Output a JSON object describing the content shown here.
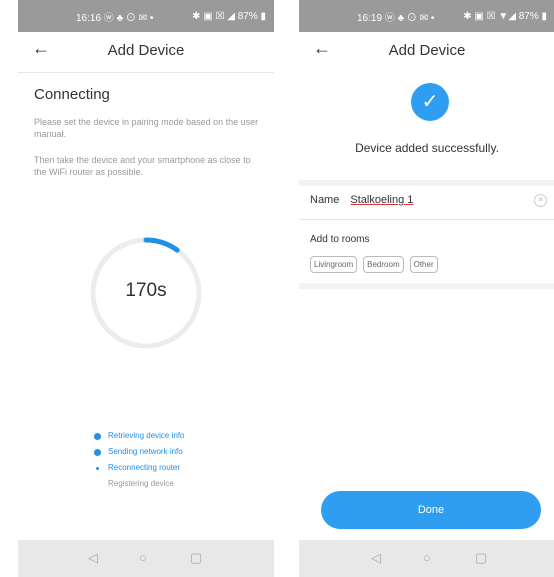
{
  "left": {
    "status": {
      "time_icons": "16:16 ⓦ ♣ ⊙ ✉ •",
      "right_icons": "✱ ▣ ☒ ◢ 87% ▮"
    },
    "header": {
      "title": "Add Device"
    },
    "heading": "Connecting",
    "instruction_1": "Please set the device in pairing mode based on the user manual.",
    "instruction_2": "Then take the device and your smartphone as close to the WiFi router as possible.",
    "countdown": "170s",
    "progress": 0.1,
    "steps": [
      {
        "label": "Retrieving device info",
        "state": "done"
      },
      {
        "label": "Sending network info",
        "state": "done"
      },
      {
        "label": "Reconnecting router",
        "state": "active"
      },
      {
        "label": "Registering device",
        "state": "pending"
      }
    ],
    "colors": {
      "accent": "#1e90e8",
      "done_text": "#1e90e8",
      "pending_text": "#999999"
    }
  },
  "right": {
    "status": {
      "time_icons": "16:19 ⓦ ♣ ⊙ ✉ •",
      "right_icons": "✱ ▣ ☒ ▼◢ 87% ▮"
    },
    "header": {
      "title": "Add Device"
    },
    "success_msg": "Device added successfully.",
    "name_label": "Name",
    "name_value": "Stalkoeling 1",
    "rooms_label": "Add to rooms",
    "rooms": [
      "Livingroom",
      "Bedroom",
      "Other"
    ],
    "done_label": "Done",
    "icons": {
      "success": "check-icon",
      "clear": "clear-icon"
    },
    "colors": {
      "accent": "#2f9ef0"
    }
  },
  "nav": {
    "back": "◁",
    "home": "○",
    "recent": "▢"
  }
}
